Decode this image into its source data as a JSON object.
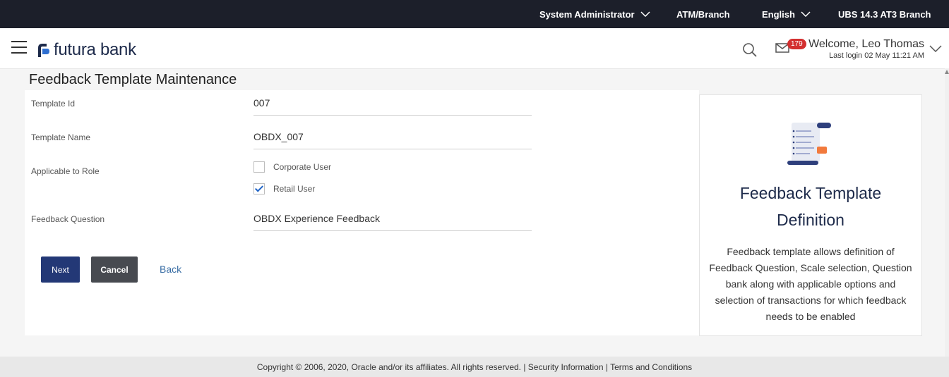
{
  "topbar": {
    "role": "System Administrator",
    "atm_branch": "ATM/Branch",
    "language": "English",
    "entity": "UBS 14.3 AT3 Branch"
  },
  "header": {
    "brand": "futura bank",
    "notification_count": "179",
    "welcome": "Welcome, Leo Thomas",
    "last_login": "Last login 02 May 11:21 AM"
  },
  "page": {
    "title": "Feedback Template Maintenance"
  },
  "form": {
    "template_id_label": "Template Id",
    "template_id_value": "007",
    "template_name_label": "Template Name",
    "template_name_value": "OBDX_007",
    "role_label": "Applicable to Role",
    "roles": [
      {
        "label": "Corporate User",
        "checked": false
      },
      {
        "label": "Retail User",
        "checked": true
      }
    ],
    "question_label": "Feedback Question",
    "question_value": "OBDX Experience Feedback"
  },
  "actions": {
    "next": "Next",
    "cancel": "Cancel",
    "back": "Back"
  },
  "info": {
    "title": "Feedback Template Definition",
    "text": "Feedback template allows definition of Feedback Question, Scale selection, Question bank along with applicable options and selection of transactions for which feedback needs to be enabled"
  },
  "footer": {
    "text": "Copyright © 2006, 2020, Oracle and/or its affiliates. All rights reserved. | Security Information | Terms and Conditions"
  },
  "colors": {
    "topbar": "#1c1f2a",
    "primary_button": "#233876",
    "secondary_button": "#474a50",
    "link": "#3a6ea5",
    "badge": "#d32f2f"
  }
}
